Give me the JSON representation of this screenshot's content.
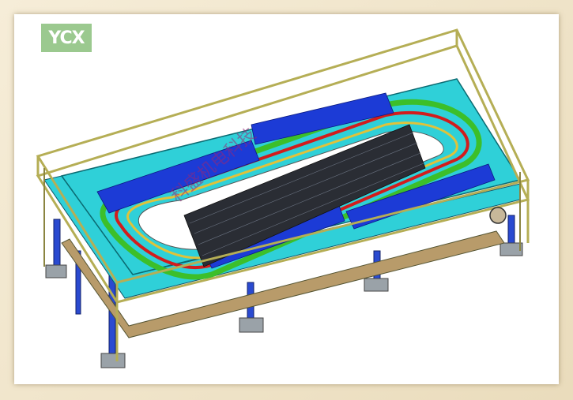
{
  "logo": {
    "text": "YCX",
    "color": "#9bc98f"
  },
  "watermark": {
    "text": "科盛机电科技"
  },
  "colors": {
    "frame": "#c9c06a",
    "table_top": "#2fd0d8",
    "belt_blue": "#1c3bd6",
    "rail_green": "#3cbf2a",
    "rail_red": "#d21c1c",
    "rail_yellow": "#e0c23a",
    "leg": "#2a4ad0"
  }
}
